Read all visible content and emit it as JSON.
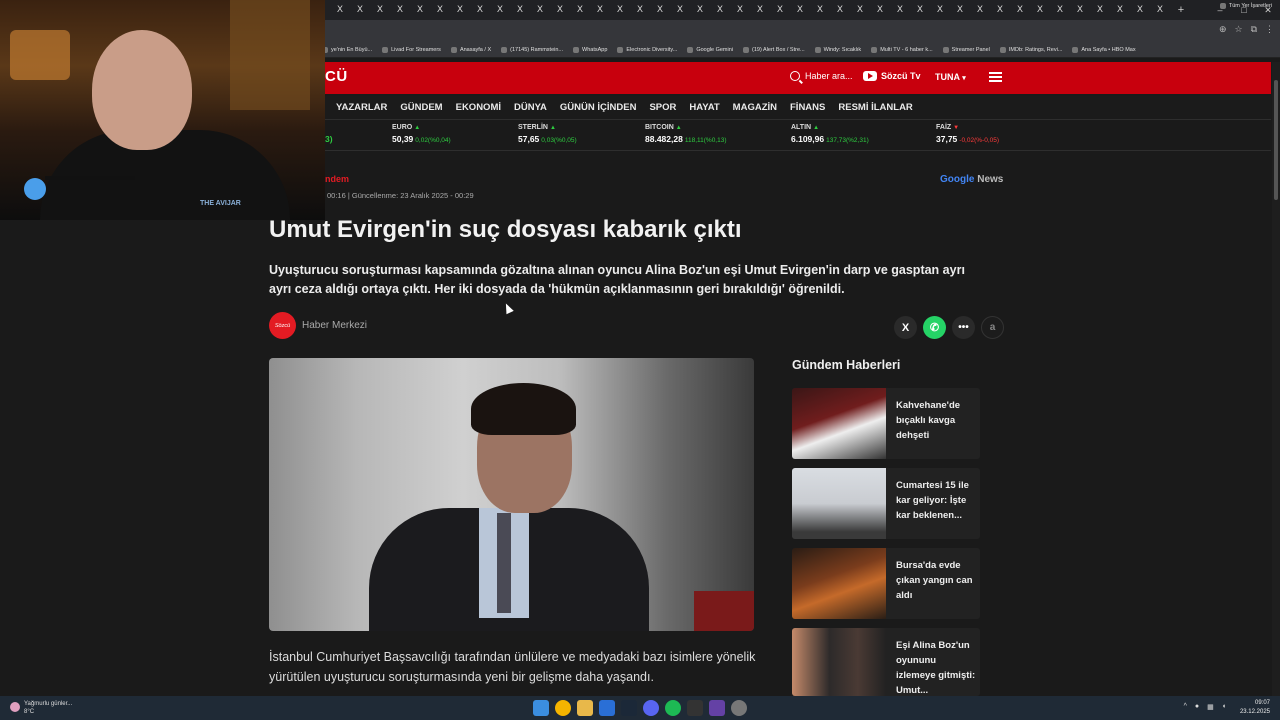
{
  "browser": {
    "tab_close_glyph": "X",
    "new_tab_glyph": "+",
    "window_controls": [
      "–",
      "□",
      "✕"
    ],
    "bookmarks": [
      "ye'nin En Büyü...",
      "Livad For Streamers",
      "Anasayfa / X",
      "(17145) Rammstein...",
      "WhatsApp",
      "Electronic Diversity...",
      "Google Gemini",
      "(19) Alert Box / Stre...",
      "Windy: Sıcaklık",
      "Multi TV - 6 haber k...",
      "Streamer Panel",
      "IMDb: Ratings, Revi...",
      "Ana Sayfa • HBO Max"
    ],
    "bookmarks_other": "Tüm Yer İşaretleri"
  },
  "site": {
    "logo": "CÜ",
    "search_placeholder": "Haber ara...",
    "tv_label": "Sözcü Tv",
    "user_label": "TUNA",
    "accent": "#c8000d"
  },
  "nav": [
    "YAZARLAR",
    "GÜNDEM",
    "EKONOMİ",
    "DÜNYA",
    "GÜNÜN İÇİNDEN",
    "SPOR",
    "HAYAT",
    "MAGAZİN",
    "FİNANS",
    "RESMİ İLANLAR"
  ],
  "ticker": [
    {
      "name": "",
      "value": "3)",
      "change": "",
      "dir": ""
    },
    {
      "name": "EURO",
      "value": "50,39",
      "change": "0,02(%0,04)",
      "dir": "up"
    },
    {
      "name": "STERLİN",
      "value": "57,65",
      "change": "0,03(%0,05)",
      "dir": "up"
    },
    {
      "name": "BITCOIN",
      "value": "88.482,28",
      "change": "118,11(%0,13)",
      "dir": "up"
    },
    {
      "name": "ALTIN",
      "value": "6.109,96",
      "change": "137,73(%2,31)",
      "dir": "up"
    },
    {
      "name": "FAİZ",
      "value": "37,75",
      "change": "-0,02(%-0,05)",
      "dir": "down"
    }
  ],
  "article": {
    "category": "ndem",
    "dates": "00:16   |   Güncellenme: 23 Aralık 2025 - 00:29",
    "google_news": [
      "Google",
      "News"
    ],
    "headline": "Umut Evirgen'in suç dosyası kabarık çıktı",
    "summary": "Uyuşturucu soruşturması kapsamında gözaltına alınan oyuncu Alina Boz'un eşi Umut Evirgen'in darp ve gasptan ayrı ayrı ceza aldığı ortaya çıktı. Her iki dosyada da 'hükmün açıklanmasının geri bırakıldığı' öğrenildi.",
    "author_logo_text": "Sözcü",
    "author": "Haber Merkezi",
    "share": {
      "x": "X",
      "more": "•••",
      "font": "a"
    },
    "body": "İstanbul Cumhuriyet Başsavcılığı tarafından ünlülere ve medyadaki bazı isimlere yönelik yürütülen uyuşturucu soruşturmasında yeni bir gelişme daha yaşandı."
  },
  "sidebar": {
    "title": "Gündem Haberleri",
    "items": [
      {
        "title": "Kahvehane'de bıçaklı kavga dehşeti"
      },
      {
        "title": "Cumartesi 15 ile kar geliyor: İşte kar beklenen..."
      },
      {
        "title": "Bursa'da evde çıkan yangın can aldı"
      },
      {
        "title": "Eşi Alina Boz'un oyununu izlemeye gitmişti: Umut..."
      }
    ]
  },
  "webcam": {
    "shirt_text": "THE AVIJAR"
  },
  "taskbar": {
    "weather_title": "Yağmurlu günler...",
    "weather_temp": "8°C",
    "time": "09:07",
    "date": "23.12.2025"
  }
}
